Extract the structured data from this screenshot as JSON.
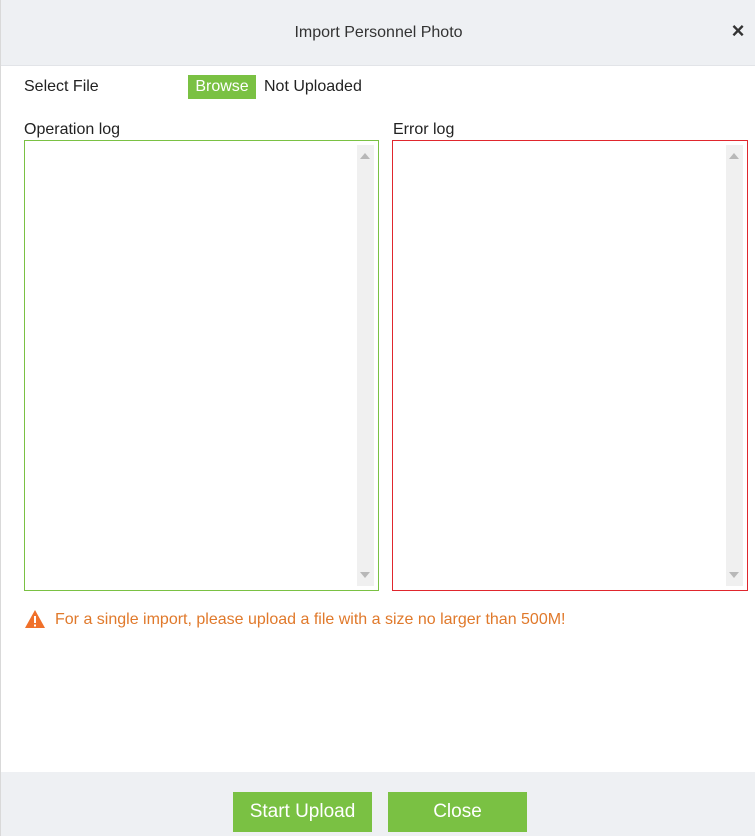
{
  "dialog": {
    "title": "Import Personnel Photo",
    "close_symbol": "×"
  },
  "select_file": {
    "label": "Select File",
    "browse_label": "Browse",
    "status": "Not Uploaded"
  },
  "logs": {
    "operation_label": "Operation log",
    "error_label": "Error log",
    "operation_content": "",
    "error_content": ""
  },
  "warning": {
    "icon": "warning-triangle-icon",
    "text": "For a single import, please upload a file with a size no larger than 500M!"
  },
  "footer": {
    "start_label": "Start Upload",
    "close_label": "Close"
  },
  "colors": {
    "accent_green": "#7ac143",
    "error_red": "#e0262d",
    "warning_orange": "#e0792b",
    "header_bg": "#eef0f3"
  }
}
